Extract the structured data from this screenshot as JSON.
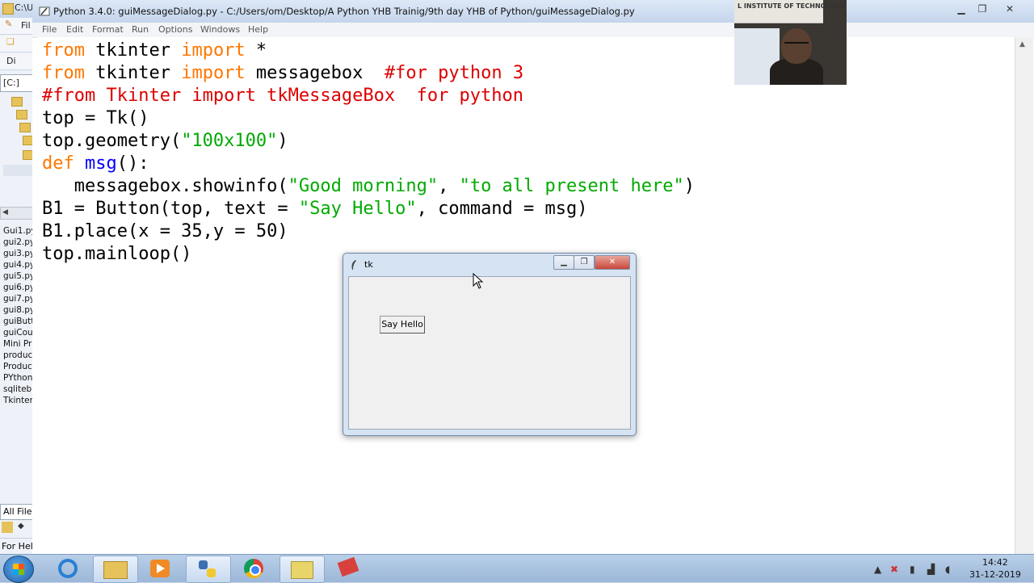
{
  "explorer": {
    "title": "C:\\U",
    "tool1": "Fil",
    "tool2": "Di",
    "drive": "[C:]",
    "files": [
      "Gui1.py",
      "gui2.py",
      "gui3.py",
      "gui4.py",
      "gui5.py",
      "gui6.py",
      "gui7.py",
      "gui8.py",
      "guiButt",
      "guiCou",
      "Mini Pr",
      "produc",
      "Produc",
      "PYthon",
      "sqliteb",
      "Tkinter"
    ],
    "filter": "All File",
    "status": "For Hel"
  },
  "idle": {
    "title": "Python 3.4.0: guiMessageDialog.py - C:/Users/om/Desktop/A Python YHB Trainig/9th day YHB of Python/guiMessageDialog.py",
    "menu": [
      "File",
      "Edit",
      "Format",
      "Run",
      "Options",
      "Windows",
      "Help"
    ],
    "code": {
      "l1": {
        "kw1": "from",
        "t1": " tkinter ",
        "kw2": "import",
        "t2": " *"
      },
      "l2": {
        "kw1": "from",
        "t1": " tkinter ",
        "kw2": "import",
        "t2": " messagebox  ",
        "cm": "#for python 3"
      },
      "l3": {
        "cm": "#from Tkinter import tkMessageBox  for python"
      },
      "l4": {
        "t": "top = Tk()"
      },
      "l5": {
        "t1": "top.geometry(",
        "st": "\"100x100\"",
        "t2": ")"
      },
      "l6": {
        "kw": "def",
        "sp": " ",
        "df": "msg",
        "t": "():"
      },
      "l7": {
        "t1": "   messagebox.showinfo(",
        "st1": "\"Good morning\"",
        "t2": ", ",
        "st2": "\"to all present here\"",
        "t3": ")"
      },
      "l8": {
        "t1": "B1 = Button(top, text = ",
        "st": "\"Say Hello\"",
        "t2": ", command = msg)"
      },
      "l9": {
        "t": "B1.place(x = 35,y = 50)"
      },
      "l10": {
        "t": "top.mainloop()"
      }
    }
  },
  "webcam": {
    "sign": "L INSTITUTE OF TECHNOLOGY"
  },
  "tk": {
    "title": "tk",
    "button_label": "Say Hello"
  },
  "taskbar": {
    "time": "14:42",
    "date": "31-12-2019"
  }
}
